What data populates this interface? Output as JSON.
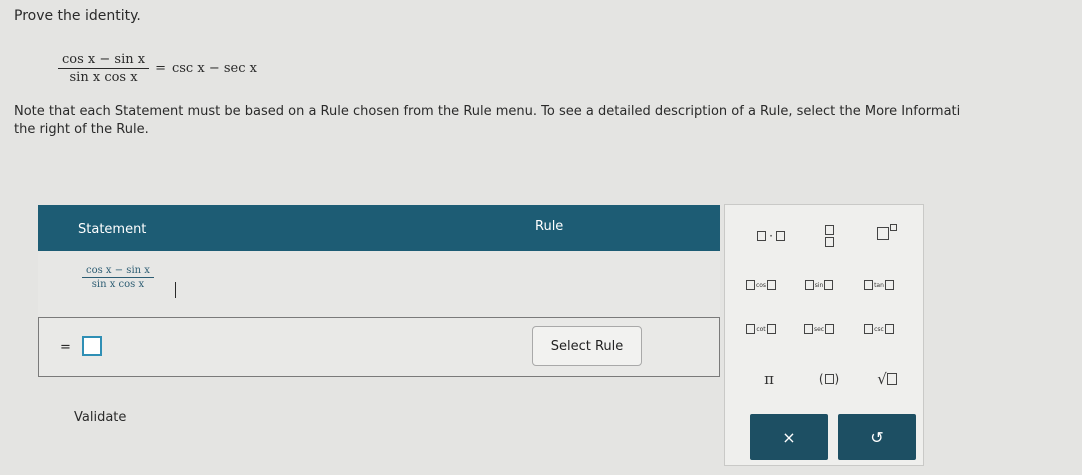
{
  "prompt": "Prove the identity.",
  "identity": {
    "lhs_numerator": "cos x − sin x",
    "lhs_denominator": "sin x cos x",
    "equals": "=",
    "rhs": "csc x − sec x"
  },
  "note": "Note that each Statement must be based on a Rule chosen from the Rule menu. To see a detailed description of a Rule, select the More Informati",
  "note_line2": "the right of the Rule.",
  "table": {
    "statement_header": "Statement",
    "rule_header": "Rule",
    "row1_numerator": "cos x − sin x",
    "row1_denominator": "sin x cos x",
    "row2_prefix": "=",
    "select_rule_label": "Select Rule"
  },
  "validate_label": "Validate",
  "palette": {
    "dot": "·",
    "cos": "cos",
    "sin": "sin",
    "tan": "tan",
    "cot": "cot",
    "sec": "sec",
    "csc": "csc",
    "pi": "π",
    "paren": "( )",
    "sqrt": "√",
    "clear": "×",
    "undo": "↺"
  }
}
